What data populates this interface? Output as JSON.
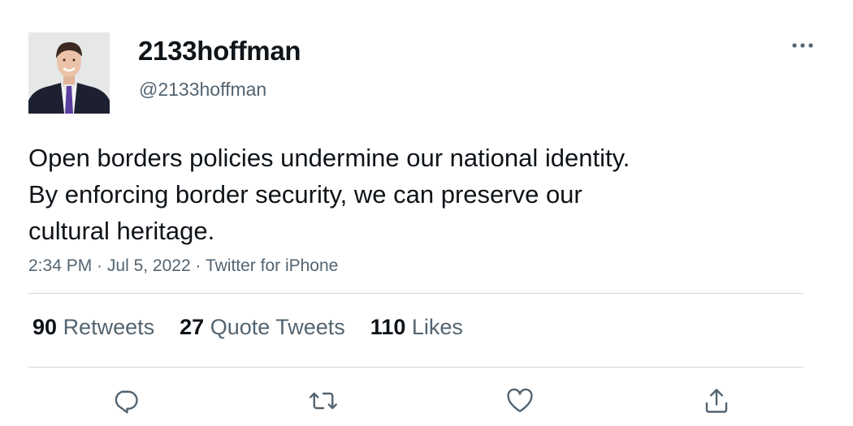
{
  "user": {
    "display_name": "2133hoffman",
    "handle": "@2133hoffman",
    "avatar_icon": "profile-photo"
  },
  "tweet": {
    "text_lines": [
      "Open borders policies undermine our national identity.",
      "By enforcing border security, we can preserve our",
      "cultural heritage."
    ],
    "time": "2:34 PM",
    "date": "Jul 5, 2022",
    "source": "Twitter for iPhone",
    "separator": " · "
  },
  "stats": [
    {
      "count": "90",
      "label": "Retweets"
    },
    {
      "count": "27",
      "label": "Quote Tweets"
    },
    {
      "count": "110",
      "label": "Likes"
    }
  ],
  "actions": [
    {
      "icon": "reply-icon"
    },
    {
      "icon": "retweet-icon"
    },
    {
      "icon": "like-icon"
    },
    {
      "icon": "share-icon"
    }
  ],
  "more_icon": "more-icon",
  "colors": {
    "text": "#0f1419",
    "secondary": "#536471",
    "divider": "#cfd9de"
  }
}
